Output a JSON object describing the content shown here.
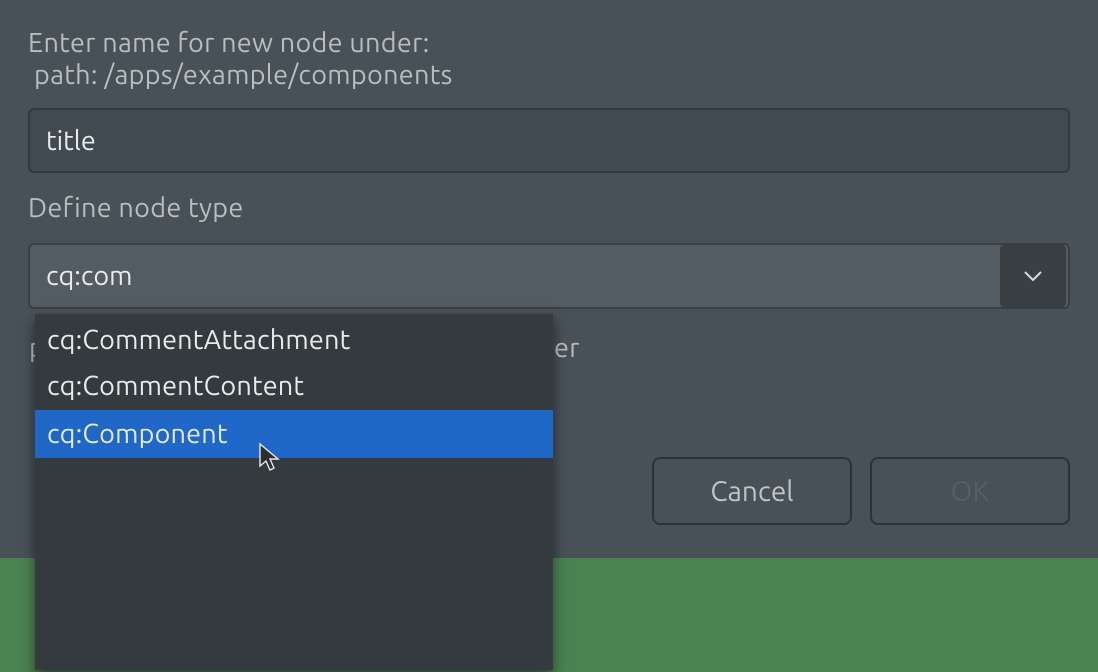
{
  "prompt": {
    "line1": "Enter name for new node under:",
    "line2": "path: /apps/example/components"
  },
  "name_input": {
    "value": "title"
  },
  "nodetype": {
    "label": "Define node type",
    "value": "cq:com"
  },
  "partial_label_left": "p",
  "partial_label_right": "er",
  "buttons": {
    "cancel": "Cancel",
    "ok": "OK"
  },
  "dropdown_items": [
    {
      "label": "cq:CommentAttachment",
      "selected": false
    },
    {
      "label": "cq:CommentContent",
      "selected": false
    },
    {
      "label": "cq:Component",
      "selected": true
    }
  ]
}
